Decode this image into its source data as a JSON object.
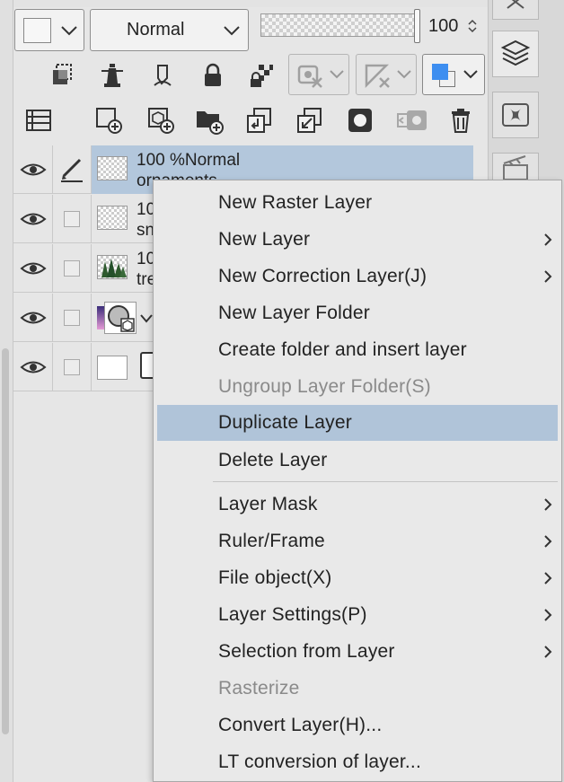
{
  "toolbar": {
    "blend_mode": "Normal",
    "opacity_value": "100",
    "opacity_fraction": 1.0,
    "colors": {
      "main": "#3d8ef0",
      "sub": "#ffffff"
    }
  },
  "layers": [
    {
      "opacity_mode": "100 %Normal",
      "name": "ornaments",
      "selected": true
    },
    {
      "opacity_mode": "10",
      "name": "sn"
    },
    {
      "opacity_mode": "10",
      "name": "tre"
    },
    {
      "opacity_mode": "",
      "name": ""
    },
    {
      "opacity_mode": "",
      "name": ""
    }
  ],
  "context_menu": {
    "items": [
      {
        "label": "New Raster Layer",
        "submenu": false,
        "enabled": true
      },
      {
        "label": "New Layer",
        "submenu": true,
        "enabled": true
      },
      {
        "label": "New Correction Layer(J)",
        "submenu": true,
        "enabled": true
      },
      {
        "label": "New Layer Folder",
        "submenu": false,
        "enabled": true
      },
      {
        "label": "Create folder and insert layer",
        "submenu": false,
        "enabled": true
      },
      {
        "label": "Ungroup Layer Folder(S)",
        "submenu": false,
        "enabled": false
      },
      {
        "label": "Duplicate Layer",
        "submenu": false,
        "enabled": true,
        "highlighted": true
      },
      {
        "label": "Delete Layer",
        "submenu": false,
        "enabled": true
      },
      {
        "label": "Layer Mask",
        "submenu": true,
        "enabled": true
      },
      {
        "label": "Ruler/Frame",
        "submenu": true,
        "enabled": true
      },
      {
        "label": "File object(X)",
        "submenu": true,
        "enabled": true
      },
      {
        "label": "Layer Settings(P)",
        "submenu": true,
        "enabled": true
      },
      {
        "label": "Selection from Layer",
        "submenu": true,
        "enabled": true
      },
      {
        "label": "Rasterize",
        "submenu": false,
        "enabled": false
      },
      {
        "label": "Convert Layer(H)...",
        "submenu": false,
        "enabled": true
      },
      {
        "label": "LT conversion of layer...",
        "submenu": false,
        "enabled": true
      }
    ]
  },
  "colors": {
    "highlight": "#b0c4d9",
    "selected_layer": "#b3c7dc",
    "panel_bg": "#e6e6e6",
    "menu_bg": "#e9e9e9",
    "disabled_text": "#8a8a8a"
  },
  "icons": {
    "layer_row_1": [
      "eye-icon",
      "pen-icon"
    ],
    "dock": [
      "close-icon",
      "layers-icon",
      "material-icon",
      "animation-icon"
    ]
  }
}
